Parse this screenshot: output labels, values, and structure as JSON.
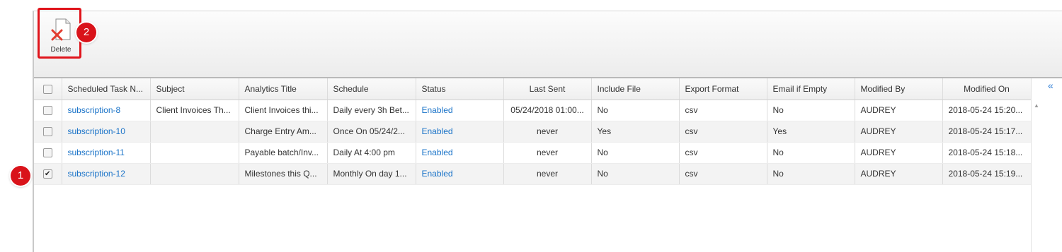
{
  "toolbar": {
    "delete_label": "Delete"
  },
  "callouts": {
    "one": "1",
    "two": "2"
  },
  "grid": {
    "columns": [
      "Scheduled Task N...",
      "Subject",
      "Analytics Title",
      "Schedule",
      "Status",
      "Last Sent",
      "Include File",
      "Export Format",
      "Email if Empty",
      "Modified By",
      "Modified On"
    ],
    "rows": [
      {
        "checked": false,
        "name": "subscription-8",
        "subject": "Client Invoices Th...",
        "analytics_title": "Client Invoices thi...",
        "schedule": "Daily every 3h Bet...",
        "status": "Enabled",
        "last_sent": "05/24/2018 01:00...",
        "include_file": "No",
        "export_format": "csv",
        "email_if_empty": "No",
        "modified_by": "AUDREY",
        "modified_on": "2018-05-24 15:20..."
      },
      {
        "checked": false,
        "name": "subscription-10",
        "subject": "",
        "analytics_title": "Charge Entry Am...",
        "schedule": "Once On 05/24/2...",
        "status": "Enabled",
        "last_sent": "never",
        "include_file": "Yes",
        "export_format": "csv",
        "email_if_empty": "Yes",
        "modified_by": "AUDREY",
        "modified_on": "2018-05-24 15:17..."
      },
      {
        "checked": false,
        "name": "subscription-11",
        "subject": "",
        "analytics_title": "Payable batch/Inv...",
        "schedule": "Daily At 4:00 pm",
        "status": "Enabled",
        "last_sent": "never",
        "include_file": "No",
        "export_format": "csv",
        "email_if_empty": "No",
        "modified_by": "AUDREY",
        "modified_on": "2018-05-24 15:18..."
      },
      {
        "checked": true,
        "name": "subscription-12",
        "subject": "",
        "analytics_title": "Milestones this Q...",
        "schedule": "Monthly On day 1...",
        "status": "Enabled",
        "last_sent": "never",
        "include_file": "No",
        "export_format": "csv",
        "email_if_empty": "No",
        "modified_by": "AUDREY",
        "modified_on": "2018-05-24 15:19..."
      }
    ]
  },
  "icons": {
    "delete": "delete-document-icon",
    "collapse": "double-chevron-left-icon",
    "scroll_up": "scroll-up-arrow-icon"
  },
  "colors": {
    "link": "#1a73c8",
    "highlight": "#e0141b",
    "badge": "#d9131a"
  }
}
